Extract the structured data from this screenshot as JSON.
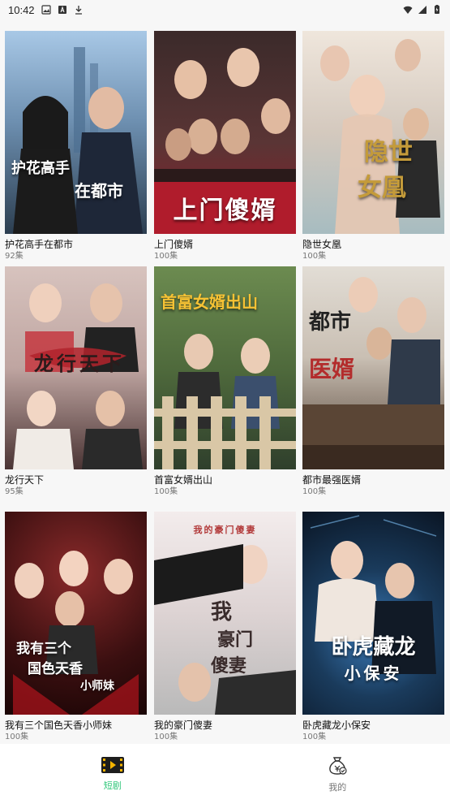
{
  "status_bar": {
    "time": "10:42"
  },
  "dramas": [
    {
      "title": "护花高手在都市",
      "episodes": "92集",
      "poster_text": [
        "护花高手",
        "在都市"
      ],
      "colors": [
        "#8fb5d6",
        "#2c3e50"
      ],
      "text_color": "#ffffff"
    },
    {
      "title": "上门傻婿",
      "episodes": "100集",
      "poster_text": [
        "上门傻婿"
      ],
      "colors": [
        "#5a2b2b",
        "#a11d2a"
      ],
      "text_color": "#ffffff"
    },
    {
      "title": "隐世女凰",
      "episodes": "100集",
      "poster_text": [
        "隐世",
        "女凰"
      ],
      "colors": [
        "#e9dfd6",
        "#9bb1b7"
      ],
      "text_color": "#c49b3a"
    },
    {
      "title": "龙行天下",
      "episodes": "95集",
      "poster_text": [
        "龙行天下"
      ],
      "colors": [
        "#c9b2ad",
        "#3e2a2b"
      ],
      "text_color": "#2b1b1b"
    },
    {
      "title": "首富女婿出山",
      "episodes": "100集",
      "poster_text": [
        "首富女婿出山"
      ],
      "colors": [
        "#6f8d4e",
        "#2f3f2c"
      ],
      "text_color": "#f6c234"
    },
    {
      "title": "都市最强医婿",
      "episodes": "100集",
      "poster_text": [
        "都市",
        "医婿"
      ],
      "colors": [
        "#d8d2c7",
        "#4c3a2e"
      ],
      "text_color": "#b32c2c"
    },
    {
      "title": "我有三个国色天香小师妹",
      "episodes": "100集",
      "poster_text": [
        "我有三个",
        "国色天香",
        "小师妹"
      ],
      "colors": [
        "#5a1a1a",
        "#2a0a0a"
      ],
      "text_color": "#ffffff"
    },
    {
      "title": "我的豪门傻妻",
      "episodes": "100集",
      "poster_text": [
        "我的豪门傻妻",
        "我",
        "豪门",
        "傻妻"
      ],
      "colors": [
        "#f2ecec",
        "#c5c5c5"
      ],
      "text_color": "#3a2c2c"
    },
    {
      "title": "卧虎藏龙小保安",
      "episodes": "100集",
      "poster_text": [
        "卧虎藏龙",
        "小保安"
      ],
      "colors": [
        "#1a3b5c",
        "#0a1524"
      ],
      "text_color": "#ffffff"
    }
  ],
  "bottom_nav": {
    "items": [
      {
        "label": "短剧",
        "icon": "film-icon",
        "active": true
      },
      {
        "label": "我的",
        "icon": "money-bag-icon",
        "active": false
      }
    ]
  },
  "theme": {
    "accent": "#31c77a",
    "background": "#f7f7f7",
    "text_primary": "#111111",
    "text_secondary": "#777777"
  }
}
